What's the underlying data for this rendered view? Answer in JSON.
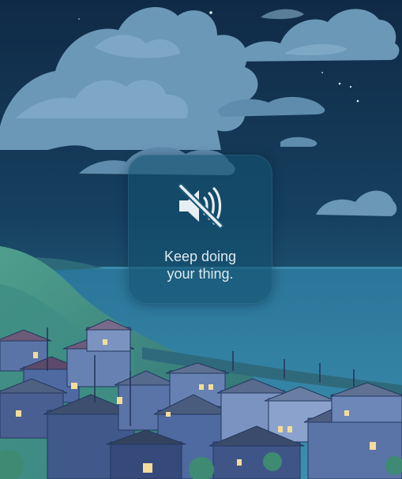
{
  "hud": {
    "icon": "speaker-muted-icon",
    "message_line1": "Keep doing",
    "message_line2": "your thing."
  },
  "colors": {
    "sky_top": "#0f2a46",
    "sky_bottom": "#1e5271",
    "sea": "#2f7fa1",
    "cloud": "#6c98b8",
    "hill": "#3f8d84",
    "town": "#3d5c8a",
    "hud_bg": "#1b5878",
    "hud_text": "#dfeaf1"
  }
}
